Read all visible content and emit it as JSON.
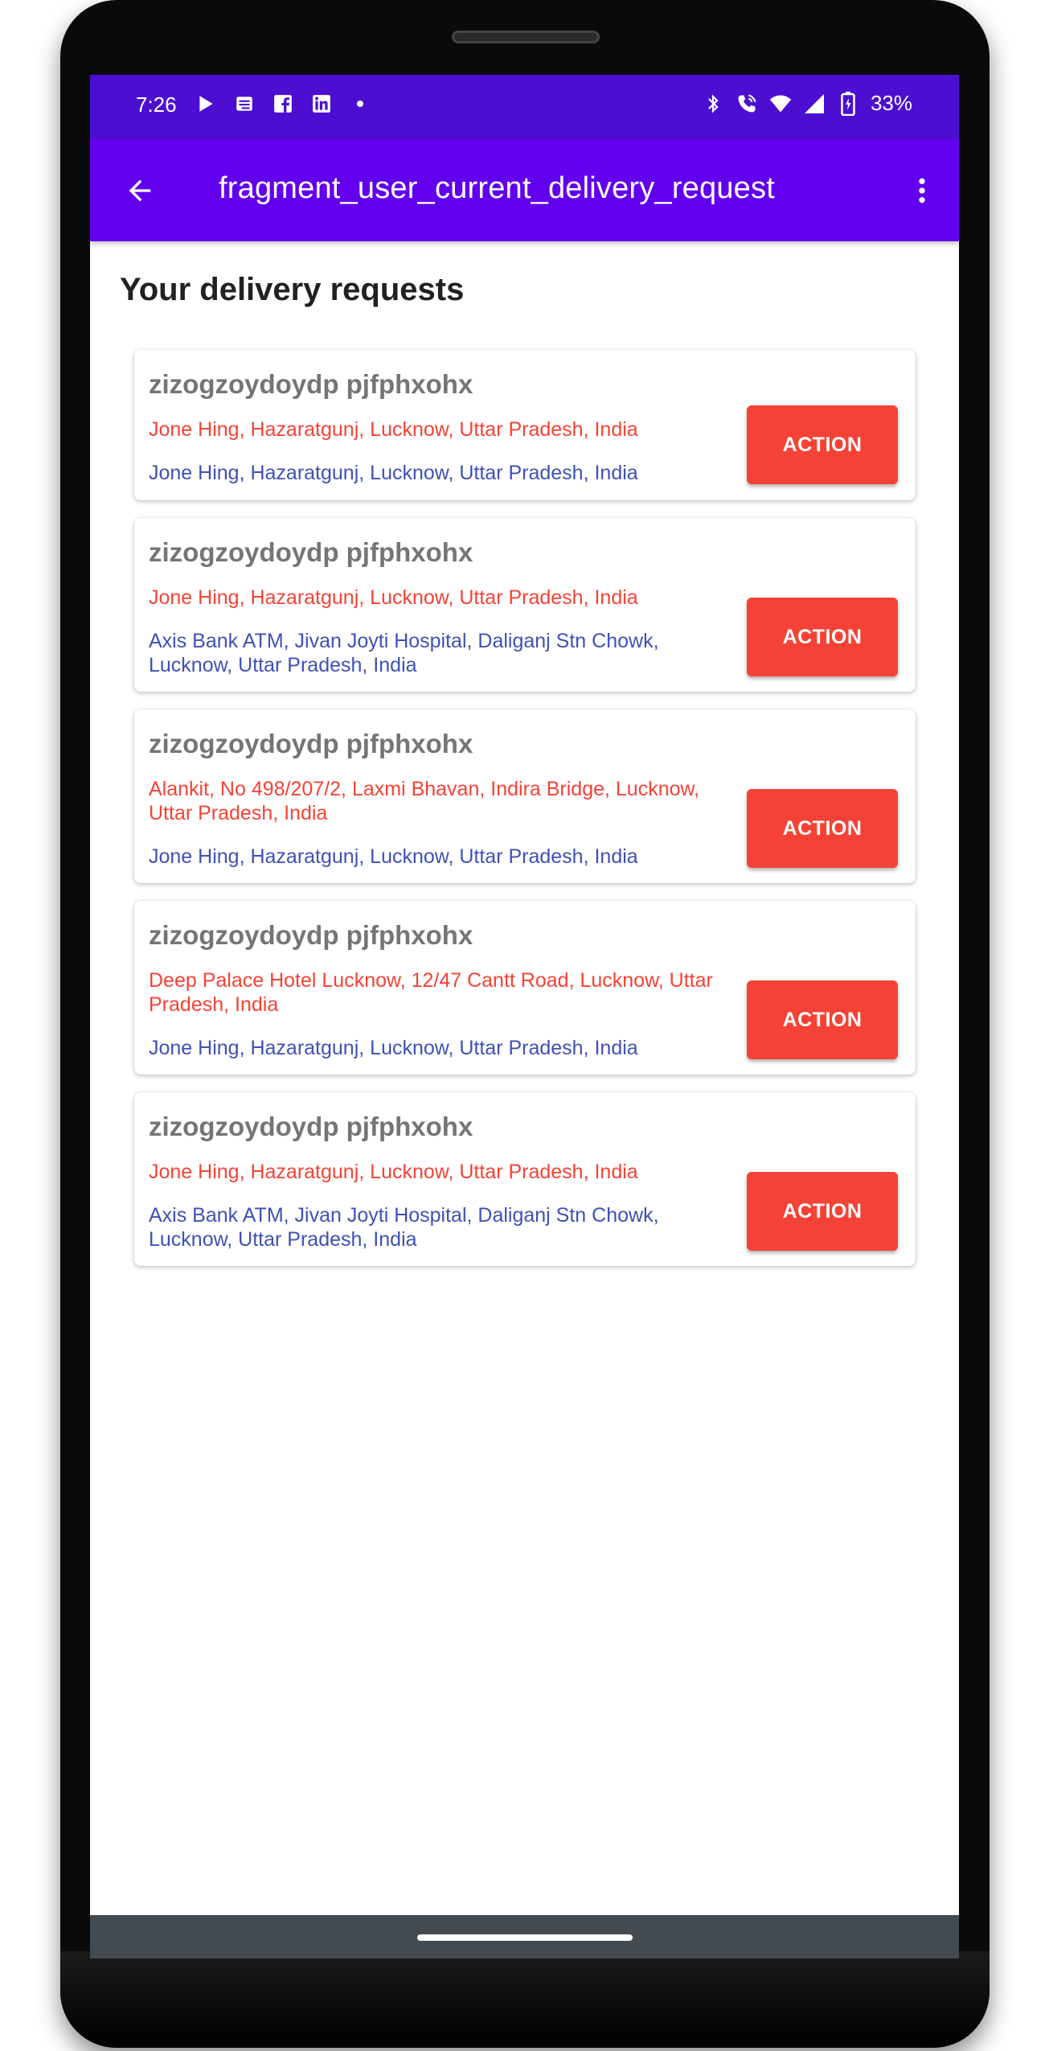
{
  "status_bar": {
    "time": "7:26",
    "battery": "33%",
    "left_icons": [
      "play-store-icon",
      "news-icon",
      "facebook-icon",
      "linkedin-icon",
      "dot-icon"
    ],
    "right_icons": [
      "bluetooth-icon",
      "wifi-calling-icon",
      "wifi-icon",
      "signal-icon",
      "battery-icon"
    ]
  },
  "app_bar": {
    "title": "fragment_user_current_delivery_request",
    "back_icon": "arrow-back-icon",
    "menu_icon": "more-vert-icon"
  },
  "page": {
    "heading": "Your delivery requests"
  },
  "colors": {
    "status_bar": "#4c0fd1",
    "app_bar": "#6200ee",
    "pickup_text": "#f44336",
    "drop_text": "#3f51b5",
    "action_button": "#f44336",
    "nav_bar": "#434b50"
  },
  "requests": [
    {
      "name": "zizogzoydoydp pjfphxohx",
      "pickup": "Jone Hing, Hazaratgunj, Lucknow, Uttar Pradesh, India",
      "drop": "Jone Hing, Hazaratgunj, Lucknow, Uttar Pradesh, India",
      "action_label": "ACTION"
    },
    {
      "name": "zizogzoydoydp pjfphxohx",
      "pickup": "Jone Hing, Hazaratgunj, Lucknow, Uttar Pradesh, India",
      "drop": "Axis Bank ATM, Jivan Joyti Hospital, Daliganj Stn Chowk, Lucknow, Uttar Pradesh, India",
      "action_label": "ACTION"
    },
    {
      "name": "zizogzoydoydp pjfphxohx",
      "pickup": "Alankit, No 498/207/2, Laxmi Bhavan, Indira Bridge, Lucknow, Uttar Pradesh, India",
      "drop": "Jone Hing, Hazaratgunj, Lucknow, Uttar Pradesh, India",
      "action_label": "ACTION"
    },
    {
      "name": "zizogzoydoydp pjfphxohx",
      "pickup": "Deep Palace Hotel Lucknow, 12/47 Cantt Road, Lucknow, Uttar Pradesh, India",
      "drop": "Jone Hing, Hazaratgunj, Lucknow, Uttar Pradesh, India",
      "action_label": "ACTION"
    },
    {
      "name": "zizogzoydoydp pjfphxohx",
      "pickup": "Jone Hing, Hazaratgunj, Lucknow, Uttar Pradesh, India",
      "drop": "Axis Bank ATM, Jivan Joyti Hospital, Daliganj Stn Chowk, Lucknow, Uttar Pradesh, India",
      "action_label": "ACTION"
    }
  ]
}
